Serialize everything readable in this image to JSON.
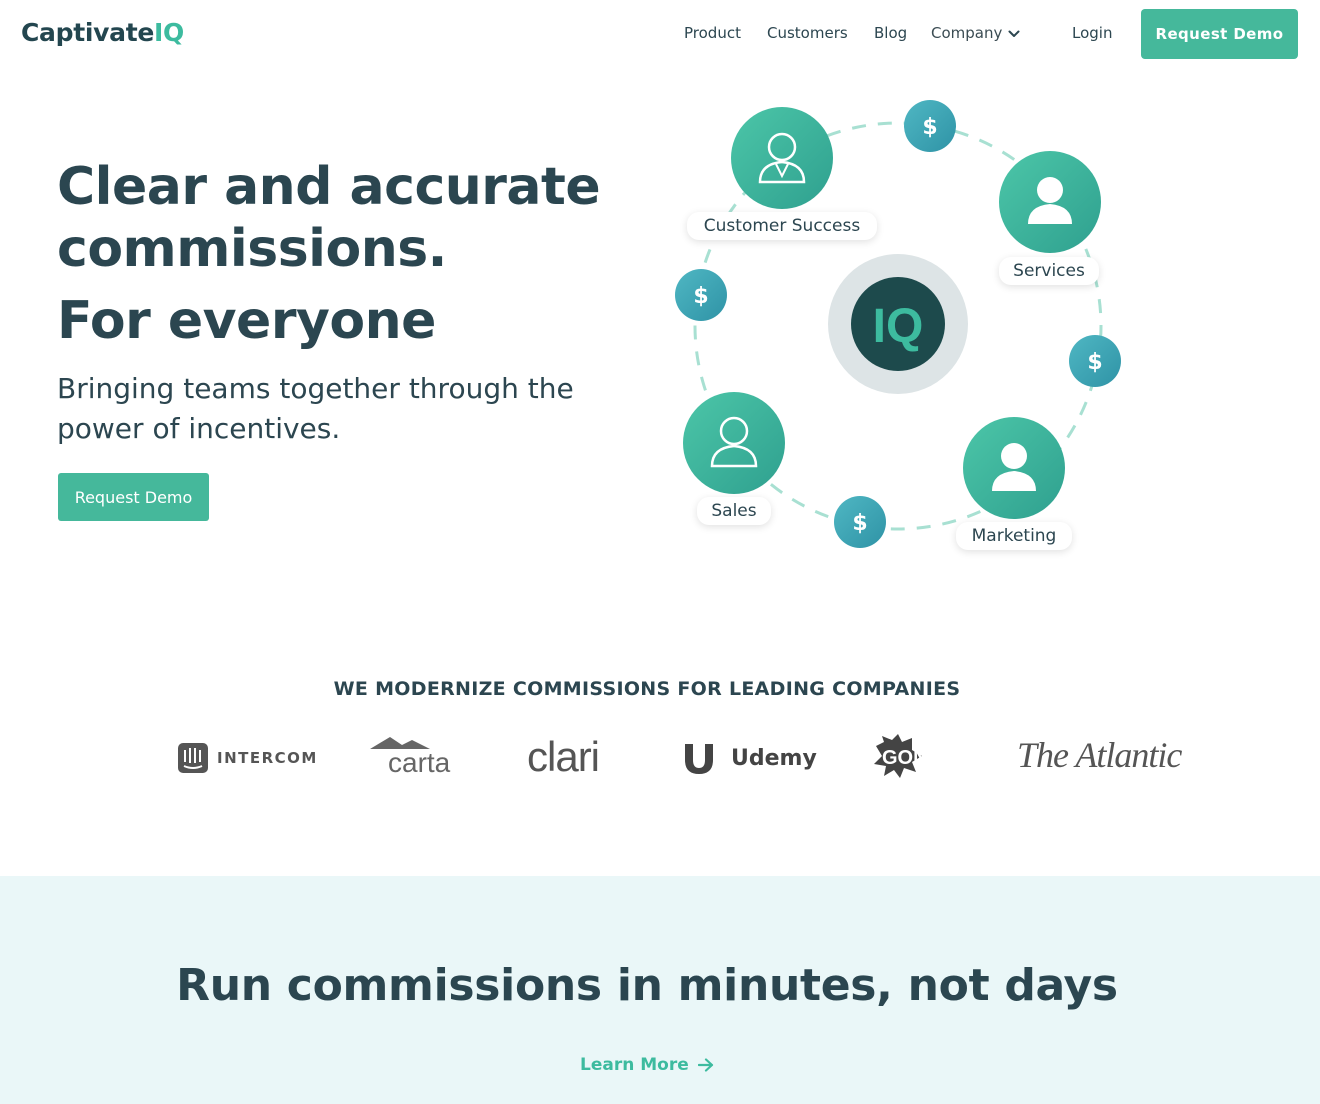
{
  "brand": {
    "name_part1": "Captivate",
    "name_part2": "IQ",
    "accent": "#45b89b",
    "dark": "#2b4650"
  },
  "nav": {
    "links": [
      "Product",
      "Customers",
      "Blog",
      "Company"
    ],
    "login": "Login",
    "cta": "Request Demo"
  },
  "hero": {
    "title": "Clear and accurate commissions.",
    "title2": "For everyone",
    "subtitle": "Bringing teams together through the power of incentives.",
    "cta": "Request Demo"
  },
  "diagram": {
    "center_label": "IQ",
    "teams": [
      "Customer Success",
      "Services",
      "Sales",
      "Marketing"
    ],
    "coin_symbol": "$"
  },
  "clients": {
    "heading": "WE MODERNIZE COMMISSIONS FOR LEADING COMPANIES",
    "logos": [
      "INTERCOM",
      "carta",
      "clari",
      "Udemy",
      "GONG",
      "The Atlantic"
    ]
  },
  "section2": {
    "title": "Run commissions in minutes, not days",
    "link": "Learn More"
  }
}
